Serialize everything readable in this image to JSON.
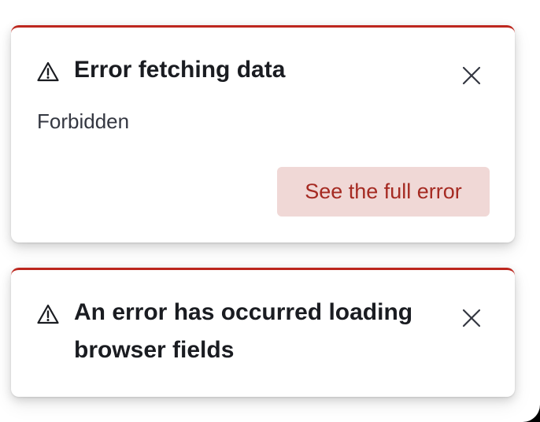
{
  "toasts": [
    {
      "title": "Error fetching data",
      "body": "Forbidden",
      "action_label": "See the full error"
    },
    {
      "title": "An error has occurred loading browser fields"
    }
  ],
  "icons": {
    "warning": "warning-icon",
    "close": "close-icon"
  },
  "colors": {
    "danger_border": "#bd271e",
    "danger_button_bg": "#f0d8d6",
    "danger_button_text": "#a52a22",
    "title_text": "#1a1c21",
    "body_text": "#343741"
  }
}
